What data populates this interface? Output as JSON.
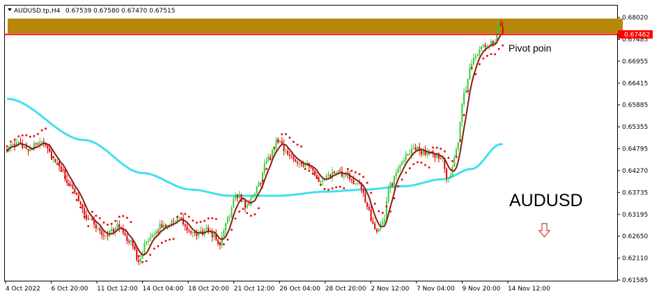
{
  "header": {
    "symbol": "AUDUSD.tp,H4",
    "ohlc": "0.67539 0.67580 0.67470 0.67515"
  },
  "annotations": {
    "pivot_label": "Pivot poin",
    "symbol_label": "AUDUSD",
    "current_price": "0.67462"
  },
  "icons": {
    "collapse": "triangle-down-icon",
    "direction": "arrow-down-icon"
  },
  "colors": {
    "bull": "#32cd32",
    "bear": "#e00000",
    "zone": "#b8860b",
    "pivot_line": "#ff0000",
    "fast_ma": "#8b1a1a",
    "slow_ma": "#40e0f0",
    "sar": "#e00000",
    "arrow": "#e05050"
  },
  "chart_data": {
    "type": "candlestick",
    "x_tick_labels": [
      "4 Oct 2022",
      "6 Oct 20:00",
      "11 Oct 12:00",
      "14 Oct 04:00",
      "18 Oct 20:00",
      "21 Oct 12:00",
      "26 Oct 04:00",
      "28 Oct 20:00",
      "2 Nov 12:00",
      "7 Nov 04:00",
      "9 Nov 20:00",
      "14 Nov 12:00"
    ],
    "y_tick_labels": [
      "0.68020",
      "0.67485",
      "0.66955",
      "0.66415",
      "0.65885",
      "0.65355",
      "0.64795",
      "0.64270",
      "0.63735",
      "0.63195",
      "0.62650",
      "0.62110",
      "0.61585"
    ],
    "ylim": [
      0.6149,
      0.6816
    ],
    "current_price": 0.67462,
    "zone": [
      0.67485,
      0.67845
    ],
    "pivot_level": 0.67462,
    "sma_slow_anchors": [
      [
        0,
        0.659
      ],
      [
        40,
        0.649
      ],
      [
        70,
        0.641
      ],
      [
        95,
        0.637
      ],
      [
        115,
        0.6355
      ],
      [
        140,
        0.6355
      ],
      [
        165,
        0.6365
      ],
      [
        185,
        0.637
      ],
      [
        205,
        0.6378
      ],
      [
        225,
        0.6395
      ],
      [
        240,
        0.642
      ],
      [
        255,
        0.648
      ]
    ],
    "close_anchors": [
      [
        0,
        0.647
      ],
      [
        6,
        0.648
      ],
      [
        12,
        0.647
      ],
      [
        18,
        0.649
      ],
      [
        26,
        0.643
      ],
      [
        34,
        0.637
      ],
      [
        42,
        0.63
      ],
      [
        50,
        0.626
      ],
      [
        58,
        0.628
      ],
      [
        64,
        0.624
      ],
      [
        68,
        0.62
      ],
      [
        72,
        0.624
      ],
      [
        80,
        0.628
      ],
      [
        88,
        0.63
      ],
      [
        96,
        0.626
      ],
      [
        104,
        0.627
      ],
      [
        110,
        0.624
      ],
      [
        114,
        0.63
      ],
      [
        118,
        0.636
      ],
      [
        124,
        0.633
      ],
      [
        130,
        0.638
      ],
      [
        134,
        0.644
      ],
      [
        140,
        0.649
      ],
      [
        146,
        0.645
      ],
      [
        154,
        0.643
      ],
      [
        162,
        0.639
      ],
      [
        170,
        0.641
      ],
      [
        176,
        0.64
      ],
      [
        182,
        0.638
      ],
      [
        186,
        0.633
      ],
      [
        190,
        0.627
      ],
      [
        194,
        0.629
      ],
      [
        198,
        0.638
      ],
      [
        204,
        0.644
      ],
      [
        210,
        0.647
      ],
      [
        216,
        0.646
      ],
      [
        224,
        0.645
      ],
      [
        228,
        0.639
      ],
      [
        232,
        0.646
      ],
      [
        236,
        0.66
      ],
      [
        240,
        0.668
      ],
      [
        244,
        0.671
      ],
      [
        248,
        0.672
      ],
      [
        252,
        0.673
      ],
      [
        254,
        0.678
      ],
      [
        256,
        0.6752
      ]
    ]
  }
}
